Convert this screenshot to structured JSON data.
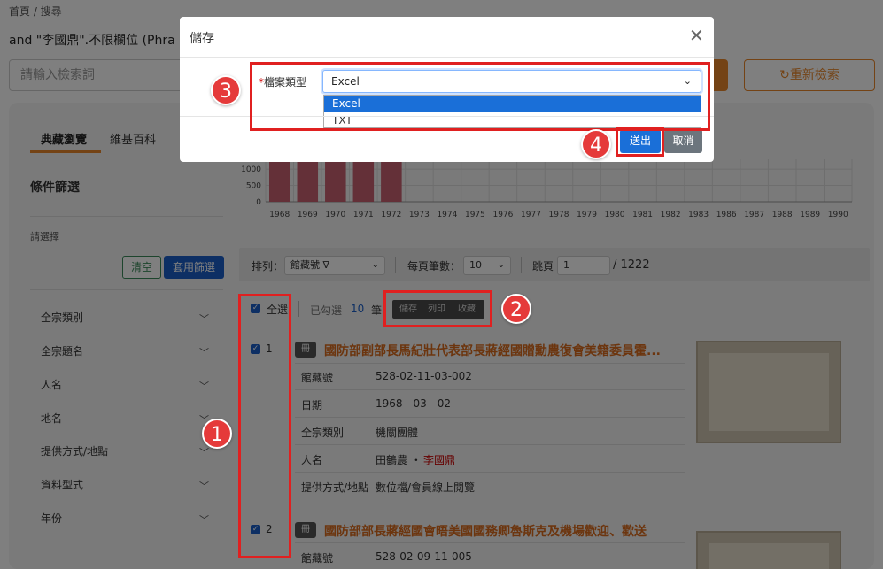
{
  "breadcrumb": "首頁 / 搜尋",
  "query_text": "and \"李國鼎\".不限欄位 (Phra",
  "search": {
    "placeholder": "請輸入檢索詞"
  },
  "reset_button": "重新檢索",
  "tabs": [
    {
      "label": "典藏瀏覽"
    },
    {
      "label": "維基百科"
    }
  ],
  "filter": {
    "title": "條件篩選",
    "choose_label": "請選擇",
    "clear_label": "清空",
    "apply_label": "套用篩選",
    "facets": [
      {
        "label": "全宗類別"
      },
      {
        "label": "全宗題名"
      },
      {
        "label": "人名"
      },
      {
        "label": "地名"
      },
      {
        "label": "提供方式/地點"
      },
      {
        "label": "資料型式"
      },
      {
        "label": "年份"
      }
    ]
  },
  "chart_data": {
    "type": "bar",
    "categories": [
      "1968",
      "1969",
      "1970",
      "1971",
      "1972",
      "1973",
      "1974",
      "1975",
      "1976",
      "1977",
      "1978",
      "1979",
      "1980",
      "1981",
      "1982",
      "1983",
      "1986",
      "1987",
      "1988",
      "1989",
      "1990"
    ],
    "values": [
      1300,
      1300,
      1300,
      1300,
      1300,
      0,
      0,
      0,
      0,
      0,
      0,
      0,
      0,
      0,
      0,
      0,
      0,
      0,
      0,
      0,
      0
    ],
    "yticks": [
      "1000",
      "500",
      "0"
    ],
    "ylim": [
      0,
      1300
    ],
    "bar_color": "#c96070",
    "grid": true
  },
  "toolbar": {
    "sort_label": "排列：",
    "sort_value": "館藏號 ∇",
    "per_page_label": "每頁筆數：",
    "per_page_value": "10",
    "jump_label": "跳頁",
    "page_value": "1",
    "total_pages": "/ 1222"
  },
  "selection": {
    "select_all_label": "全選",
    "selected_text": "已勾選",
    "selected_count": "10",
    "selected_unit": "筆",
    "actions": [
      {
        "label": "儲存"
      },
      {
        "label": "列印"
      },
      {
        "label": "收藏"
      }
    ]
  },
  "records": [
    {
      "index": "1",
      "badge": "冊",
      "title": "國防部副部長馬紀壯代表部長蔣經國贈勳農復會美籍委員霍...",
      "fields": [
        {
          "label": "館藏號",
          "value": "528-02-11-03-002"
        },
        {
          "label": "日期",
          "value": "1968 - 03 - 02"
        },
        {
          "label": "全宗類別",
          "value": "機關團體"
        },
        {
          "label": "人名",
          "value": "田鶴農 ・"
        },
        {
          "label": "提供方式/地點",
          "value": "數位檔/會員線上閱覽"
        }
      ],
      "person_link": "李國鼎"
    },
    {
      "index": "2",
      "badge": "冊",
      "title": "國防部部長蔣經國會晤美國國務卿魯斯克及機場歡迎、歡送",
      "fields": [
        {
          "label": "館藏號",
          "value": "528-02-09-11-005"
        }
      ]
    }
  ],
  "modal": {
    "title": "儲存",
    "field_star": "*",
    "field_label": "檔案類型",
    "select_value": "Excel",
    "options": [
      {
        "label": "Excel"
      },
      {
        "label": "TXT"
      }
    ],
    "submit_label": "送出",
    "cancel_label": "取消"
  },
  "callouts": [
    "1",
    "2",
    "3",
    "4"
  ],
  "colors": {
    "accent": "#e8862a",
    "primary": "#1a5fc8",
    "title": "#d86a1d",
    "callout": "#e02020"
  }
}
